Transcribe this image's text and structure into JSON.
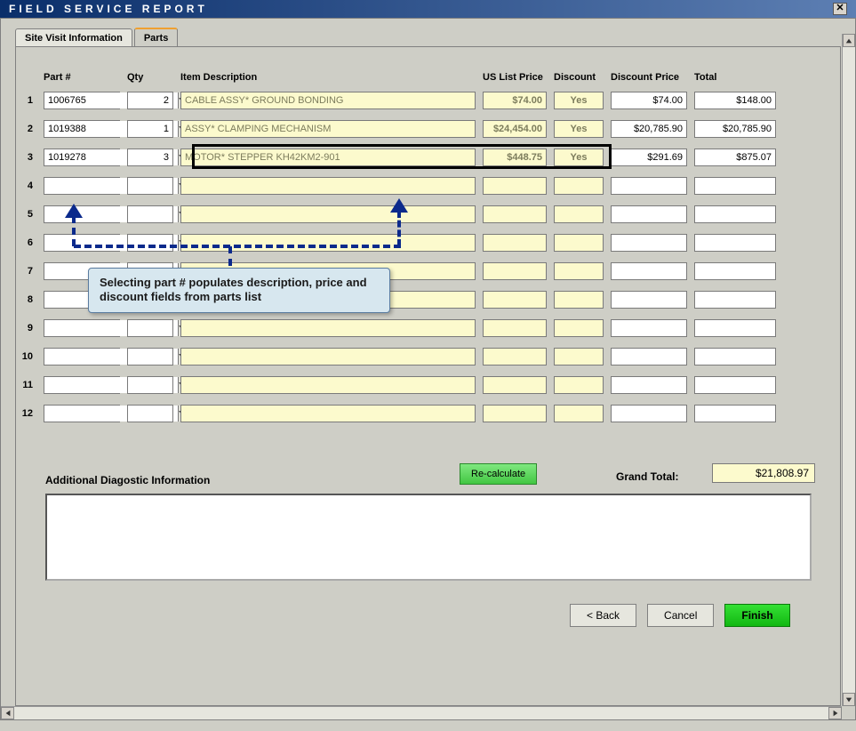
{
  "window": {
    "title": "FIELD SERVICE REPORT"
  },
  "tabs": {
    "site": "Site Visit Information",
    "parts": "Parts"
  },
  "headers": {
    "part": "Part #",
    "qty": "Qty",
    "desc": "Item Description",
    "list": "US List Price",
    "disc": "Discount",
    "discprice": "Discount Price",
    "total": "Total"
  },
  "rows": [
    {
      "n": "1",
      "part": "1006765",
      "qty": "2",
      "desc": "CABLE ASSY* GROUND BONDING",
      "list": "$74.00",
      "disc": "Yes",
      "discprice": "$74.00",
      "total": "$148.00"
    },
    {
      "n": "2",
      "part": "1019388",
      "qty": "1",
      "desc": "ASSY* CLAMPING MECHANISM",
      "list": "$24,454.00",
      "disc": "Yes",
      "discprice": "$20,785.90",
      "total": "$20,785.90"
    },
    {
      "n": "3",
      "part": "1019278",
      "qty": "3",
      "desc": "MOTOR* STEPPER KH42KM2-901",
      "list": "$448.75",
      "disc": "Yes",
      "discprice": "$291.69",
      "total": "$875.07"
    },
    {
      "n": "4",
      "part": "",
      "qty": "",
      "desc": "",
      "list": "",
      "disc": "",
      "discprice": "",
      "total": ""
    },
    {
      "n": "5",
      "part": "",
      "qty": "",
      "desc": "",
      "list": "",
      "disc": "",
      "discprice": "",
      "total": ""
    },
    {
      "n": "6",
      "part": "",
      "qty": "",
      "desc": "",
      "list": "",
      "disc": "",
      "discprice": "",
      "total": ""
    },
    {
      "n": "7",
      "part": "",
      "qty": "",
      "desc": "",
      "list": "",
      "disc": "",
      "discprice": "",
      "total": ""
    },
    {
      "n": "8",
      "part": "",
      "qty": "",
      "desc": "",
      "list": "",
      "disc": "",
      "discprice": "",
      "total": ""
    },
    {
      "n": "9",
      "part": "",
      "qty": "",
      "desc": "",
      "list": "",
      "disc": "",
      "discprice": "",
      "total": ""
    },
    {
      "n": "10",
      "part": "",
      "qty": "",
      "desc": "",
      "list": "",
      "disc": "",
      "discprice": "",
      "total": ""
    },
    {
      "n": "11",
      "part": "",
      "qty": "",
      "desc": "",
      "list": "",
      "disc": "",
      "discprice": "",
      "total": ""
    },
    {
      "n": "12",
      "part": "",
      "qty": "",
      "desc": "",
      "list": "",
      "disc": "",
      "discprice": "",
      "total": ""
    }
  ],
  "callout": "Selecting part # populates description, price and discount fields from parts list",
  "recalc": "Re-calculate",
  "grand_label": "Grand Total:",
  "grand_value": "$21,808.97",
  "diag_label": "Additional Diagostic Information",
  "buttons": {
    "back": "< Back",
    "cancel": "Cancel",
    "finish": "Finish"
  }
}
